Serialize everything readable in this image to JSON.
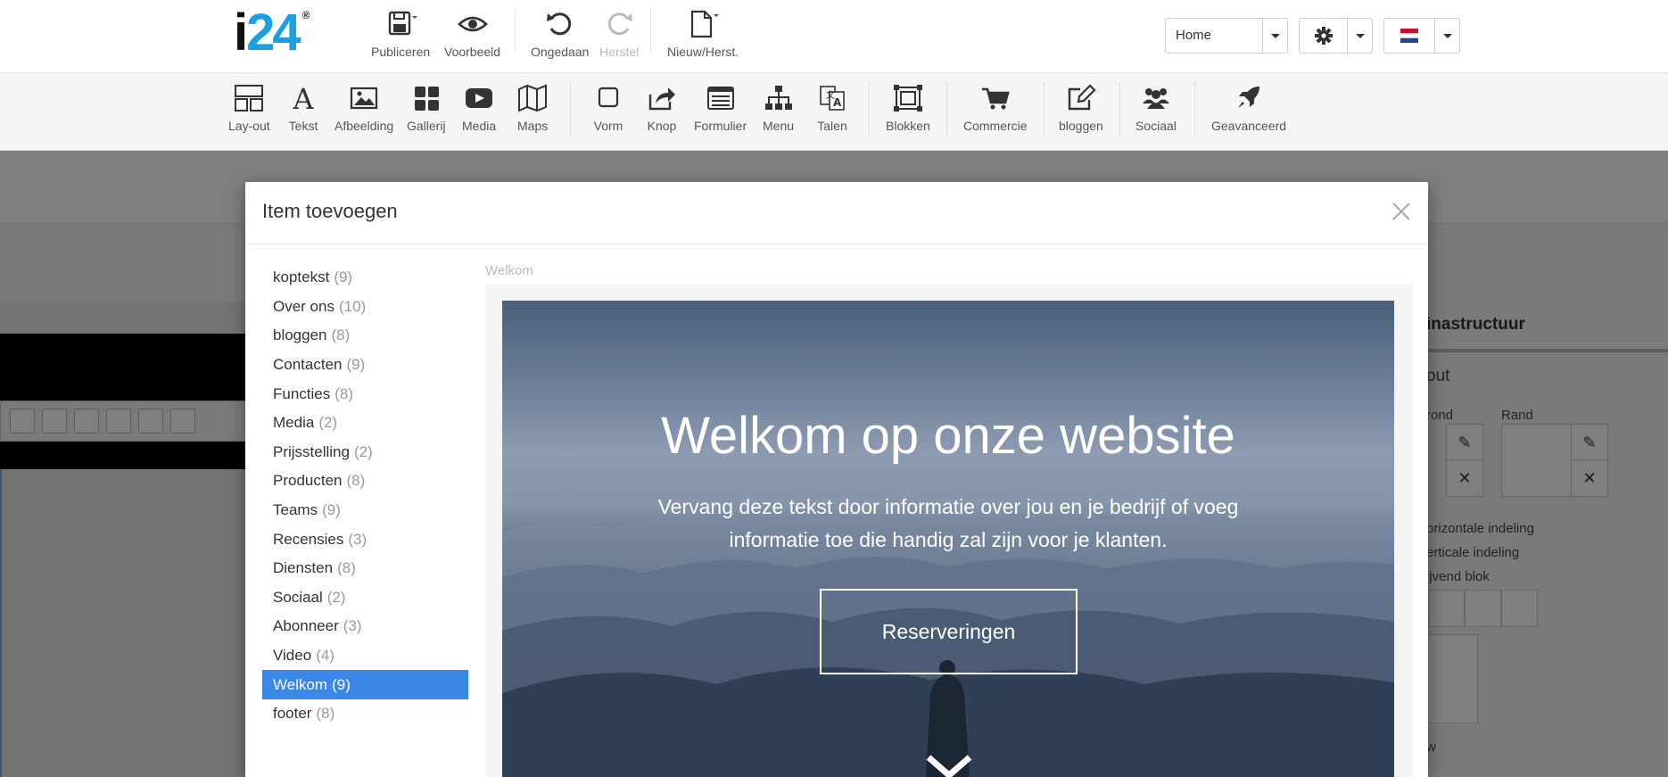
{
  "app": {
    "logo": {
      "i": "i",
      "num": "24",
      "reg": "®"
    }
  },
  "topbar": {
    "publish": "Publiceren",
    "preview": "Voorbeeld",
    "undo": "Ongedaan",
    "redo": "Herstel",
    "new_restore": "Nieuw/Herst.",
    "page_select": "Home"
  },
  "toolbar": {
    "items": [
      {
        "label": "Lay-out"
      },
      {
        "label": "Tekst"
      },
      {
        "label": "Afbeelding"
      },
      {
        "label": "Gallerij"
      },
      {
        "label": "Media"
      },
      {
        "label": "Maps"
      },
      {
        "label": "Vorm"
      },
      {
        "label": "Knop"
      },
      {
        "label": "Formulier"
      },
      {
        "label": "Menu"
      },
      {
        "label": "Talen"
      },
      {
        "label": "Blokken"
      },
      {
        "label": "Commercie"
      },
      {
        "label": "bloggen"
      },
      {
        "label": "Sociaal"
      },
      {
        "label": "Geavanceerd"
      }
    ]
  },
  "background": {
    "panel_title": "inastructuur",
    "panel_sub": "out",
    "rond": "rond",
    "rand": "Rand",
    "opt1": "orizontale indeling",
    "opt2": "erticale indeling",
    "opt3": "ijvend blok",
    "w": "w"
  },
  "modal": {
    "title": "Item toevoegen",
    "categories": [
      {
        "name": "koptekst",
        "count": "(9)"
      },
      {
        "name": "Over ons",
        "count": "(10)"
      },
      {
        "name": "bloggen",
        "count": "(8)"
      },
      {
        "name": "Contacten",
        "count": "(9)"
      },
      {
        "name": "Functies",
        "count": "(8)"
      },
      {
        "name": "Media",
        "count": "(2)"
      },
      {
        "name": "Prijsstelling",
        "count": "(2)"
      },
      {
        "name": "Producten",
        "count": "(8)"
      },
      {
        "name": "Teams",
        "count": "(9)"
      },
      {
        "name": "Recensies",
        "count": "(3)"
      },
      {
        "name": "Diensten",
        "count": "(8)"
      },
      {
        "name": "Sociaal",
        "count": "(2)"
      },
      {
        "name": "Abonneer",
        "count": "(3)"
      },
      {
        "name": "Video",
        "count": "(4)"
      },
      {
        "name": "Welkom",
        "count": "(9)"
      },
      {
        "name": "footer",
        "count": "(8)"
      }
    ],
    "selected_category": "Welkom",
    "preview_label": "Welkom",
    "preview": {
      "title": "Welkom op onze website",
      "subtitle": "Vervang deze tekst door informatie over jou en je bedrijf of voeg informatie toe die handig zal zijn voor je klanten.",
      "button": "Reserveringen"
    }
  },
  "colors": {
    "brand_blue": "#1ba1e2",
    "active_blue": "#3a87e8"
  }
}
